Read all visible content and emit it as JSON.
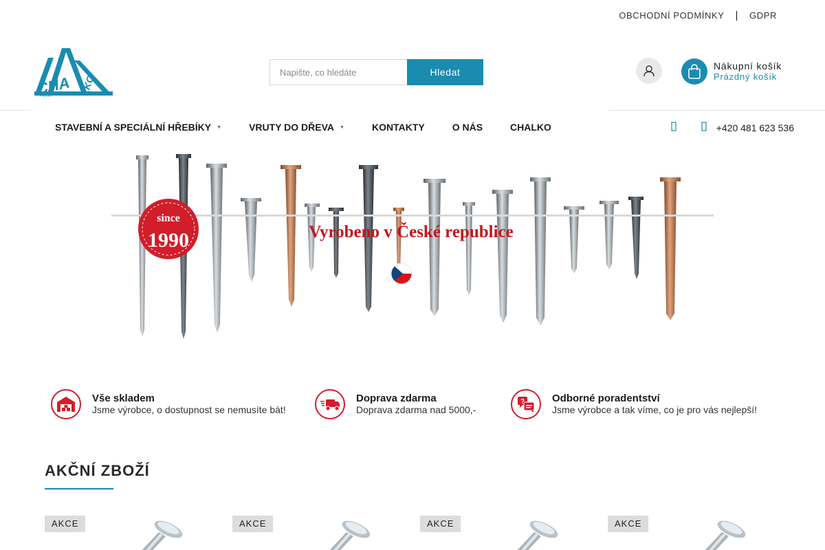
{
  "top_links": {
    "terms": "OBCHODNÍ PODMÍNKY",
    "separator": "|",
    "gdpr": "GDPR"
  },
  "logo": {
    "text": "CHALKO",
    "subtext": "PŘÍKRY"
  },
  "search": {
    "placeholder": "Napište, co hledáte",
    "button_label": "Hledat"
  },
  "account": {
    "icon": "user-icon"
  },
  "cart": {
    "icon": "shopping-bag-icon",
    "title": "Nákupní košík",
    "status": "Prázdný košík"
  },
  "nav": {
    "items": [
      {
        "label": "STAVEBNÍ A SPECIÁLNÍ HŘEBÍKY",
        "has_submenu": true
      },
      {
        "label": "VRUTY DO DŘEVA",
        "has_submenu": true
      },
      {
        "label": "KONTAKTY",
        "has_submenu": false
      },
      {
        "label": "O NÁS",
        "has_submenu": false
      },
      {
        "label": "CHALKO",
        "has_submenu": false
      }
    ],
    "phone": "+420 481 623 536"
  },
  "banner": {
    "badge_top": "since",
    "badge_year": "1990",
    "headline": "Vyrobeno v České republice"
  },
  "features": [
    {
      "icon": "warehouse-icon",
      "title": "Vše skladem",
      "desc": "Jsme výrobce, o dostupnost se nemusíte bát!"
    },
    {
      "icon": "delivery-truck-icon",
      "title": "Doprava zdarma",
      "desc": "Doprava zdarma nad 5000,-"
    },
    {
      "icon": "advice-chat-icon",
      "title": "Odborné poradentství",
      "desc": "Jsme výrobce a tak víme, co je pro vás nejlepší!"
    }
  ],
  "section": {
    "title": "AKČNÍ ZBOŽÍ"
  },
  "products": [
    {
      "badge": "AKCE"
    },
    {
      "badge": "AKCE"
    },
    {
      "badge": "AKCE"
    },
    {
      "badge": "AKCE"
    }
  ],
  "colors": {
    "accent": "#1a8cb0",
    "badge_red": "#d21e2a",
    "headline_red": "#c4161c"
  }
}
